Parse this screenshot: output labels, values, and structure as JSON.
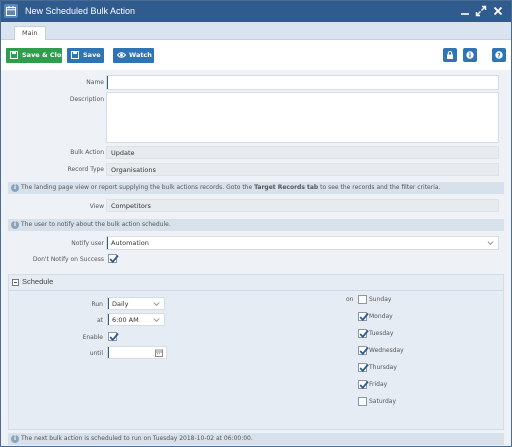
{
  "window": {
    "title": "New Scheduled Bulk Action"
  },
  "tabs": [
    {
      "label": "Main"
    }
  ],
  "toolbar": {
    "save_close_label": "Save & Close",
    "save_label": "Save",
    "watch_label": "Watch"
  },
  "form": {
    "name_label": "Name",
    "name_value": "",
    "description_label": "Description",
    "description_value": "",
    "bulk_action_label": "Bulk Action",
    "bulk_action_value": "Update",
    "record_type_label": "Record Type",
    "record_type_value": "Organisations",
    "view_label": "View",
    "view_value": "Competitors",
    "notify_user_label": "Notify user",
    "notify_user_value": "Automation",
    "dont_notify_label": "Don't Notify on Success",
    "dont_notify_checked": true
  },
  "info": {
    "landing_pre": "The landing page view or report supplying the bulk actions records. Goto the ",
    "landing_bold": "Target Records tab",
    "landing_post": " to see the records and the filter criteria.",
    "notify_text": "The user to notify about the bulk action schedule.",
    "next_run_text": "The next bulk action is scheduled to run on Tuesday 2018-10-02 at 06:00:00."
  },
  "schedule": {
    "header": "Schedule",
    "run_label": "Run",
    "run_value": "Daily",
    "at_label": "at",
    "at_value": "6:00 AM",
    "enable_label": "Enable",
    "enable_checked": true,
    "until_label": "until",
    "until_value": "",
    "on_label": "on",
    "days": [
      {
        "label": "Sunday",
        "checked": false
      },
      {
        "label": "Monday",
        "checked": true
      },
      {
        "label": "Tuesday",
        "checked": true
      },
      {
        "label": "Wednesday",
        "checked": true
      },
      {
        "label": "Thursday",
        "checked": true
      },
      {
        "label": "Friday",
        "checked": true
      },
      {
        "label": "Saturday",
        "checked": false
      }
    ]
  },
  "colors": {
    "titlebar": "#2f5b8e",
    "save_close": "#2e9e4d",
    "primary": "#2f74b5",
    "check": "#2f5b8e"
  },
  "icons": {
    "title": "calendar-icon",
    "minimize": "minimize-icon",
    "maximize": "maximize-icon",
    "close": "close-icon",
    "save": "save-icon",
    "watch": "eye-icon",
    "lock": "lock-icon",
    "info": "info-icon",
    "help": "help-icon"
  }
}
